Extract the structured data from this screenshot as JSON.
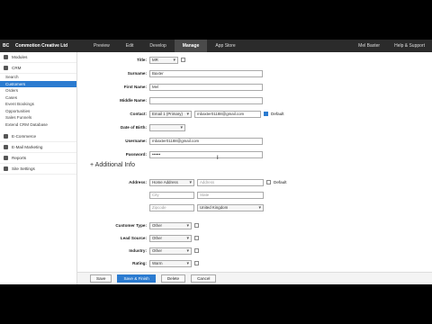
{
  "topbar": {
    "logo": "BC",
    "site_name": "Commotion Creative Ltd",
    "tabs": [
      "Preview",
      "Edit",
      "Develop",
      "Manage",
      "App Store"
    ],
    "active_tab": "Manage",
    "user": "Mel Baxter",
    "help": "Help & Support"
  },
  "sidebar": {
    "modules": "Modules",
    "crm": "CRM",
    "crm_items": [
      "Search",
      "Customers",
      "Orders",
      "Cases",
      "Event Bookings",
      "Opportunities",
      "Sales Funnels",
      "Extend CRM Database"
    ],
    "active_item": "Customers",
    "sections": [
      "E-Commerce",
      "E-Mail Marketing",
      "Reports",
      "Site Settings"
    ]
  },
  "form": {
    "title_label": "Title:",
    "title_value": "MR",
    "surname_label": "Surname:",
    "surname_value": "Baxter",
    "first_name_label": "First Name:",
    "first_name_value": "Mel",
    "middle_name_label": "Middle Name:",
    "middle_name_value": "",
    "contact_label": "Contact:",
    "contact_type": "Email 1 (Primary)",
    "contact_value": "mbaxter01188@gmail.com",
    "contact_default": "Default",
    "dob_label": "Date of Birth:",
    "username_label": "Username:",
    "username_value": "mbaxter01188@gmail.com",
    "password_label": "Password:",
    "password_value": "••••••"
  },
  "additional": {
    "heading": "Additional Info",
    "address_label": "Address:",
    "address_type": "Home Address",
    "address_placeholder": "Address",
    "address_default": "Default",
    "city_placeholder": "City",
    "state_placeholder": "State",
    "zipcode_placeholder": "Zipcode",
    "country": "United Kingdom",
    "customer_type_label": "Customer Type:",
    "customer_type_value": "Other",
    "lead_source_label": "Lead Source:",
    "lead_source_value": "Other",
    "industry_label": "Industry:",
    "industry_value": "Other",
    "rating_label": "Rating:",
    "rating_value": "Warm"
  },
  "buttons": {
    "save": "Save",
    "save_and_finish": "Save & Finish",
    "delete": "Delete",
    "cancel": "Cancel"
  }
}
